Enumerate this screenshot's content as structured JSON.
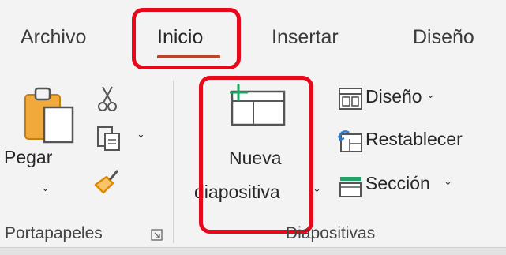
{
  "tabs": {
    "archivo": "Archivo",
    "inicio": "Inicio",
    "insertar": "Insertar",
    "diseno": "Diseño"
  },
  "portapapeles": {
    "paste_label": "Pegar",
    "group_label": "Portapapeles"
  },
  "diapositivas": {
    "new_slide_line1": "Nueva",
    "new_slide_line2": "diapositiva",
    "layout_label": "Diseño",
    "reset_label": "Restablecer",
    "section_label": "Sección",
    "group_label": "Diapositivas"
  },
  "colors": {
    "tab_underline": "#b7472a",
    "highlight_frame": "#e8081c",
    "icon_green": "#21a366",
    "icon_blue": "#2b7cd3",
    "brush_orange": "#f0a30a"
  },
  "icons": [
    "cut-icon",
    "copy-icon",
    "format-painter-icon",
    "paste-icon",
    "new-slide-icon",
    "layout-icon",
    "reset-icon",
    "section-icon",
    "dialog-launcher-icon"
  ]
}
